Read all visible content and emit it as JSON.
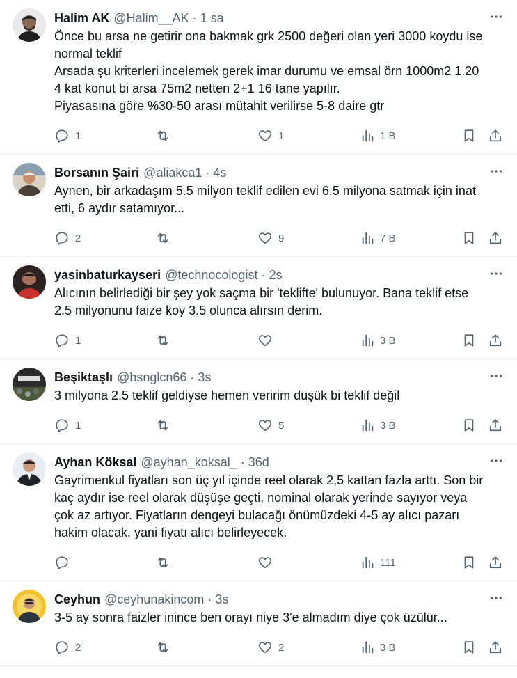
{
  "tweets": [
    {
      "name": "Halim AK",
      "handle": "@Halim__AK",
      "dot": "·",
      "time": "1 sa",
      "text": "Önce bu arsa ne getirir ona bakmak grk 2500 değeri olan yeri 3000 koydu ise normal teklif\nArsada şu kriterleri incelemek gerek imar durumu ve emsal örn 1000m2 1.20 4 kat konut bi arsa 75m2 netten 2+1 16 tane yapılır.\nPiyasasına göre %30-50 arası mütahit verilirse 5-8 daire gtr",
      "replies": "1",
      "retweets": "",
      "likes": "1",
      "views": "1 B",
      "avatar_color": "#3a3a3a"
    },
    {
      "name": "Borsanın Şairi",
      "handle": "@aliakca1",
      "dot": "·",
      "time": "4s",
      "text": "Aynen, bir arkadaşım 5.5 milyon teklif edilen evi 6.5 milyona satmak için inat etti, 6 aydır satamıyor...",
      "replies": "2",
      "retweets": "",
      "likes": "9",
      "views": "7 B",
      "avatar_color": "#c9a27a"
    },
    {
      "name": "yasinbaturkayseri",
      "handle": "@technocologist",
      "dot": "·",
      "time": "2s",
      "text": "Alıcının belirlediği bir şey yok saçma bir 'teklifte' bulunuyor. Bana teklif etse 2.5 milyonunu faize koy 3.5 olunca alırsın derim.",
      "replies": "1",
      "retweets": "",
      "likes": "",
      "views": "3 B",
      "avatar_color": "#5a3b2e"
    },
    {
      "name": "Beşiktaşlı",
      "handle": "@hsnglcn66",
      "dot": "·",
      "time": "3s",
      "text": "3 milyona 2.5 teklif geldiyse hemen veririm düşük bi teklif değil",
      "replies": "1",
      "retweets": "",
      "likes": "5",
      "views": "3 B",
      "avatar_color": "#2b2b2b"
    },
    {
      "name": "Ayhan Köksal",
      "handle": "@ayhan_koksal_",
      "dot": "·",
      "time": "36d",
      "text": "Gayrimenkul fiyatları son üç yıl içinde reel olarak 2,5 kattan fazla arttı. Son bir kaç aydır ise reel olarak düşüşe geçti, nominal olarak yerinde sayıyor veya çok az artıyor. Fiyatların dengeyi bulacağı önümüzdeki 4-5 ay alıcı pazarı hakim olacak, yani fiyatı alıcı belirleyecek.",
      "replies": "",
      "retweets": "",
      "likes": "",
      "views": "111",
      "avatar_color": "#e8eef3"
    },
    {
      "name": "Ceyhun",
      "handle": "@ceyhunakincom",
      "dot": "·",
      "time": "3s",
      "text": "3-5 ay sonra faizler inince ben orayı niye 3'e almadım diye çok üzülür...",
      "replies": "2",
      "retweets": "",
      "likes": "2",
      "views": "3 B",
      "avatar_color": "#f2c230"
    }
  ]
}
